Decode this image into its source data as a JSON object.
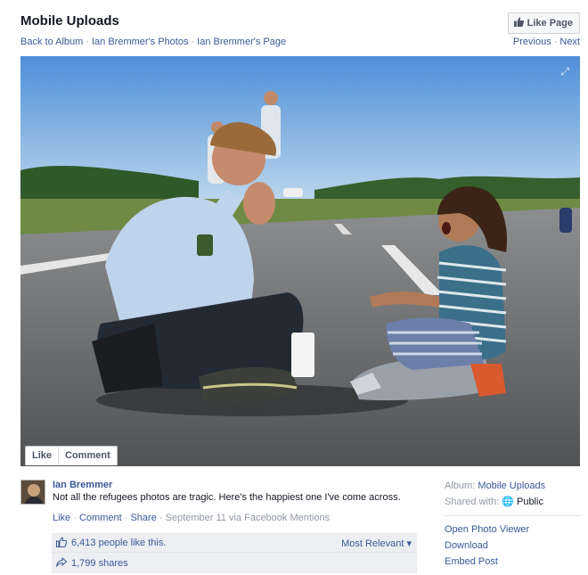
{
  "header": {
    "title": "Mobile Uploads",
    "breadcrumbs": [
      "Back to Album",
      "Ian Bremmer's Photos",
      "Ian Bremmer's Page"
    ],
    "like_page_label": "Like Page",
    "previous_label": "Previous",
    "next_label": "Next"
  },
  "photo": {
    "like_label": "Like",
    "comment_label": "Comment"
  },
  "post": {
    "author": "Ian Bremmer",
    "caption": "Not all the refugees photos are tragic. Here's the happiest one I've come across.",
    "actions": {
      "like": "Like",
      "comment": "Comment",
      "share": "Share",
      "date": "September 11",
      "via": "via Facebook Mentions"
    },
    "likes_text": "6,413 people like this.",
    "sort_label": "Most Relevant",
    "shares_text": "1,799 shares"
  },
  "sidebar": {
    "album_label": "Album:",
    "album_value": "Mobile Uploads",
    "shared_label": "Shared with:",
    "shared_value": "Public",
    "links": [
      "Open Photo Viewer",
      "Download",
      "Embed Post"
    ]
  },
  "colors": {
    "link": "#3b5998",
    "muted": "#9197a3",
    "box_bg": "#eceef2"
  }
}
